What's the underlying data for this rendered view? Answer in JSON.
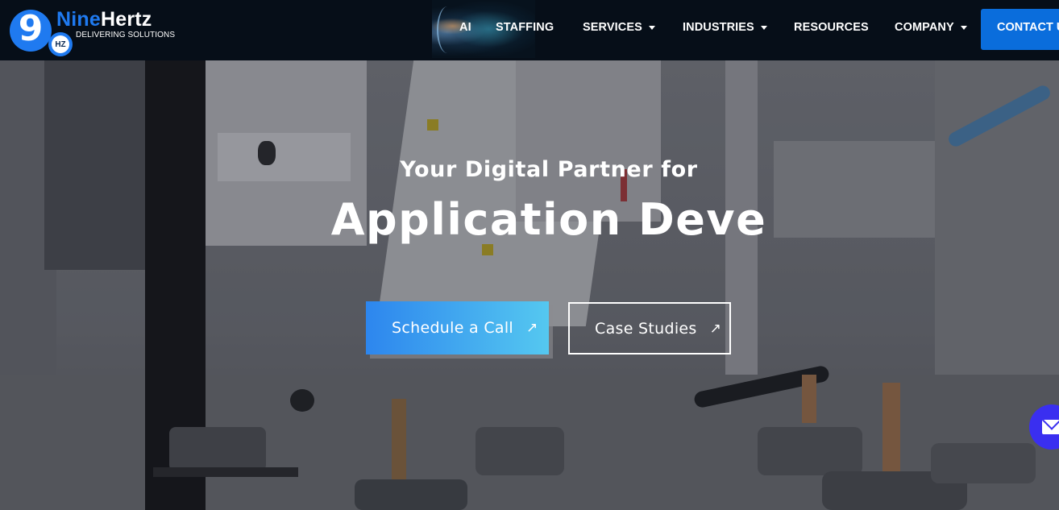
{
  "brand": {
    "logo_glyph": "9",
    "logo_badge": "HZ",
    "name_part1": "Nine",
    "name_part2": "Hertz",
    "tagline": "DELIVERING SOLUTIONS",
    "colors": {
      "brand_blue": "#1f7af0",
      "header_bg": "#060e18"
    }
  },
  "nav": {
    "items": [
      {
        "label": "AI",
        "has_dropdown": false
      },
      {
        "label": "STAFFING",
        "has_dropdown": false
      },
      {
        "label": "SERVICES",
        "has_dropdown": true
      },
      {
        "label": "INDUSTRIES",
        "has_dropdown": true
      },
      {
        "label": "RESOURCES",
        "has_dropdown": false
      },
      {
        "label": "COMPANY",
        "has_dropdown": true
      }
    ],
    "contact_label": "CONTACT US",
    "contact_color": "#0a6ddc"
  },
  "hero": {
    "subtitle": "Your Digital Partner for",
    "title": "Application Deve",
    "primary_button": {
      "label": "Schedule a Call",
      "icon": "arrow-up-right-icon",
      "arrow": "↗"
    },
    "secondary_button": {
      "label": "Case Studies",
      "icon": "arrow-up-right-icon",
      "arrow": "↗"
    },
    "background_description": "industrial robotic assembly line video"
  },
  "floating": {
    "mail_button_icon": "envelope-icon",
    "mail_button_color": "#3a2ff0"
  }
}
